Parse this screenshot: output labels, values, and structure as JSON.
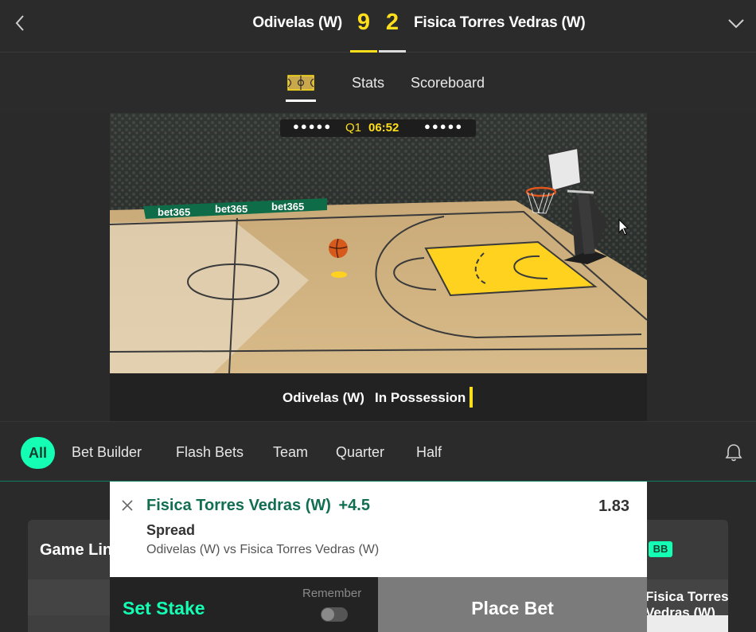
{
  "header": {
    "home_team": "Odivelas (W)",
    "away_team": "Fisica Torres Vedras (W)",
    "home_score": "9",
    "away_score": "2",
    "back_icon": "chevron-left-icon",
    "collapse_icon": "chevron-down-icon"
  },
  "view_tabs": {
    "court_icon": "basketball-court-icon",
    "stats": "Stats",
    "scoreboard": "Scoreboard",
    "active": "court"
  },
  "match_clock": {
    "home_dots": "●●●●●",
    "away_dots": "●●●●●",
    "quarter": "Q1",
    "time": "06:52"
  },
  "pitch": {
    "ad_boards": [
      "bet365",
      "bet365",
      "bet365"
    ]
  },
  "possession": {
    "team": "Odivelas (W)",
    "label": "In Possession"
  },
  "filters": {
    "items": [
      "All",
      "Bet Builder",
      "Flash Bets",
      "Team",
      "Quarter",
      "Half"
    ],
    "active": "All",
    "bell_icon": "bell-icon"
  },
  "market": {
    "title": "Game Lines",
    "bb_badge": "BB",
    "away_column": "Fisica Torres Vedras (W)"
  },
  "betslip": {
    "selection": "Fisica Torres Vedras (W)",
    "handicap": "+4.5",
    "odds": "1.83",
    "market": "Spread",
    "fixture": "Odivelas (W) vs Fisica Torres Vedras (W)",
    "set_stake": "Set Stake",
    "remember": "Remember",
    "place_bet": "Place Bet"
  },
  "colors": {
    "accent": "#14ffb4",
    "score": "#ffdf1b",
    "selection": "#126e51"
  }
}
